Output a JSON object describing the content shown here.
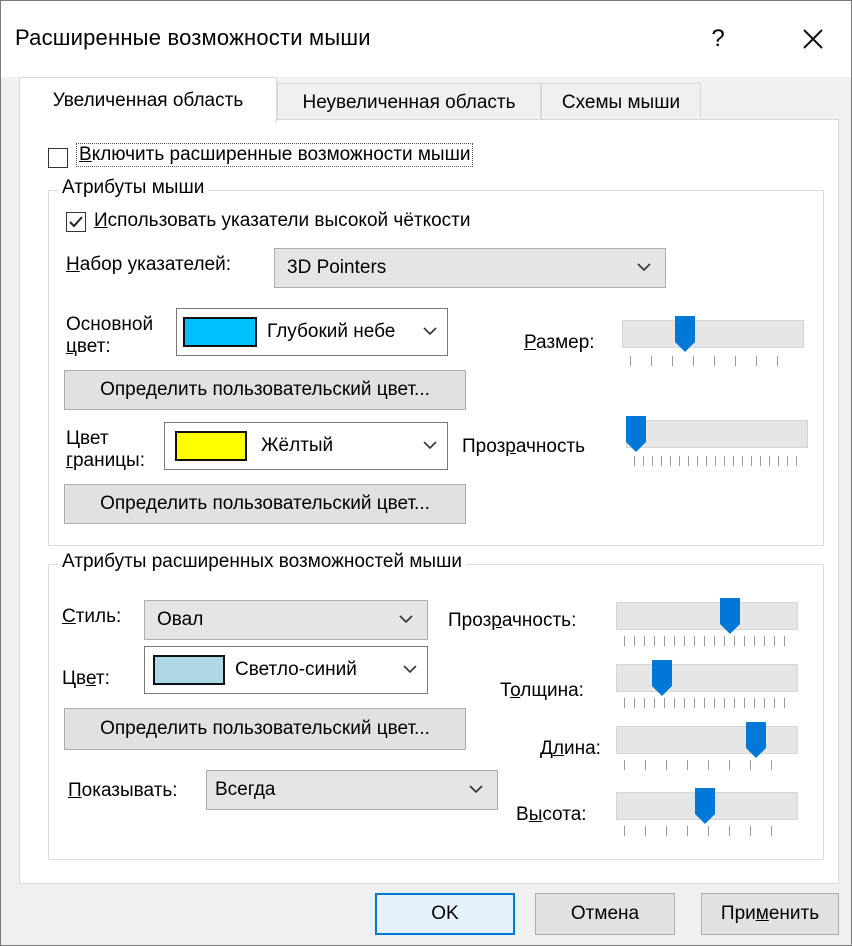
{
  "window": {
    "title": "Расширенные возможности мыши",
    "help_label": "?",
    "close_icon": "close-icon"
  },
  "tabs": [
    {
      "label": "Увеличенная область",
      "active": true
    },
    {
      "label": "Неувеличенная область",
      "active": false
    },
    {
      "label": "Схемы мыши",
      "active": false
    }
  ],
  "enable_checkbox": {
    "label_pre": "В",
    "label_rest": "ключить расширенные возможности мыши",
    "checked": false
  },
  "mouse_attrs": {
    "title": "Атрибуты мыши",
    "hd_checkbox": {
      "label_pre": "И",
      "label_rest": "спользовать указатели высокой чёткости",
      "checked": true
    },
    "pointer_set_label_pre": "Н",
    "pointer_set_label_rest": "абор указателей:",
    "pointer_set_value": "3D Pointers",
    "main_color_label_1": "Основной",
    "main_color_label_2_pre": "ц",
    "main_color_label_2_rest": "вет:",
    "main_color_value": "Глубокий небе",
    "main_color_swatch": "#00bfff",
    "custom_color_button": "Определить пользовательский цвет...",
    "border_color_label_1": "Цвет",
    "border_color_label_2_pre": "г",
    "border_color_label_2_rest": "раницы:",
    "border_color_value": "Жёлтый",
    "border_color_swatch": "#ffff00",
    "custom_color_button_2": "Определить пользовательский цвет...",
    "size_label_pre": "Р",
    "size_label_rest": "азмер:",
    "size_level": 0.3,
    "transparency_label_pre": "Проз",
    "transparency_label_u": "р",
    "transparency_label_rest": "ачность",
    "transparency_level": 0.0
  },
  "enhanced_attrs": {
    "title": "Атрибуты расширенных возможностей мыши",
    "style_label_pre": "С",
    "style_label_rest": "тиль:",
    "style_value": "Овал",
    "color_label_pre": "Цв",
    "color_label_u": "е",
    "color_label_rest": "т:",
    "color_value": "Светло-синий",
    "color_swatch": "#add8e6",
    "custom_color_button": "Определить пользовательский цвет...",
    "show_label_pre": "П",
    "show_label_rest": "оказывать:",
    "show_value": "Всегда",
    "transparency_label_pre": "Проз",
    "transparency_label_u": "р",
    "transparency_label_rest": "ачность:",
    "transparency_level": 0.6,
    "thickness_label_pre": "Т",
    "thickness_label_u": "о",
    "thickness_label_rest": "лщина:",
    "thickness_level": 0.2,
    "length_label_pre": "Д",
    "length_label_u": "л",
    "length_label_rest": "ина:",
    "length_level": 0.75,
    "height_label_pre": "В",
    "height_label_u": "ы",
    "height_label_rest": "сота:",
    "height_level": 0.45
  },
  "footer": {
    "ok": "OK",
    "cancel": "Отмена",
    "apply_pre": "При",
    "apply_u": "м",
    "apply_rest": "енить"
  },
  "colors": {
    "accent": "#0078d7",
    "thumb": "#0078d7"
  }
}
